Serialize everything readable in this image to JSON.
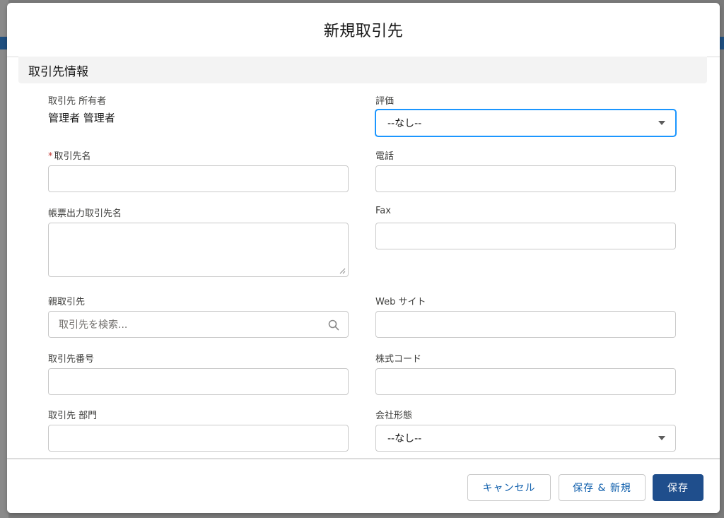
{
  "modal": {
    "title": "新規取引先"
  },
  "section": {
    "title": "取引先情報"
  },
  "fields": {
    "owner": {
      "label": "取引先 所有者",
      "value": "管理者 管理者"
    },
    "rating": {
      "label": "評価",
      "selected": "--なし--"
    },
    "account_name": {
      "required_mark": "*",
      "label": "取引先名",
      "value": ""
    },
    "phone": {
      "label": "電話",
      "value": ""
    },
    "invoice_name": {
      "label": "帳票出力取引先名",
      "value": ""
    },
    "fax": {
      "label": "Fax",
      "value": ""
    },
    "parent_account": {
      "label": "親取引先",
      "placeholder": "取引先を検索..."
    },
    "website": {
      "label": "Web サイト",
      "value": ""
    },
    "account_number": {
      "label": "取引先番号",
      "value": ""
    },
    "ticker": {
      "label": "株式コード",
      "value": ""
    },
    "division": {
      "label": "取引先 部門",
      "value": ""
    },
    "ownership": {
      "label": "会社形態",
      "selected": "--なし--"
    }
  },
  "footer": {
    "cancel_label": "キャンセル",
    "save_new_label": "保存 & 新規",
    "save_label": "保存"
  },
  "colors": {
    "primary": "#1f4e8c",
    "focus": "#1b96ff",
    "link": "#0b5cab",
    "required": "#c23934"
  },
  "icons": {
    "search": "search-icon",
    "dropdown": "chevron-down-icon",
    "resize": "resize-handle-icon"
  }
}
